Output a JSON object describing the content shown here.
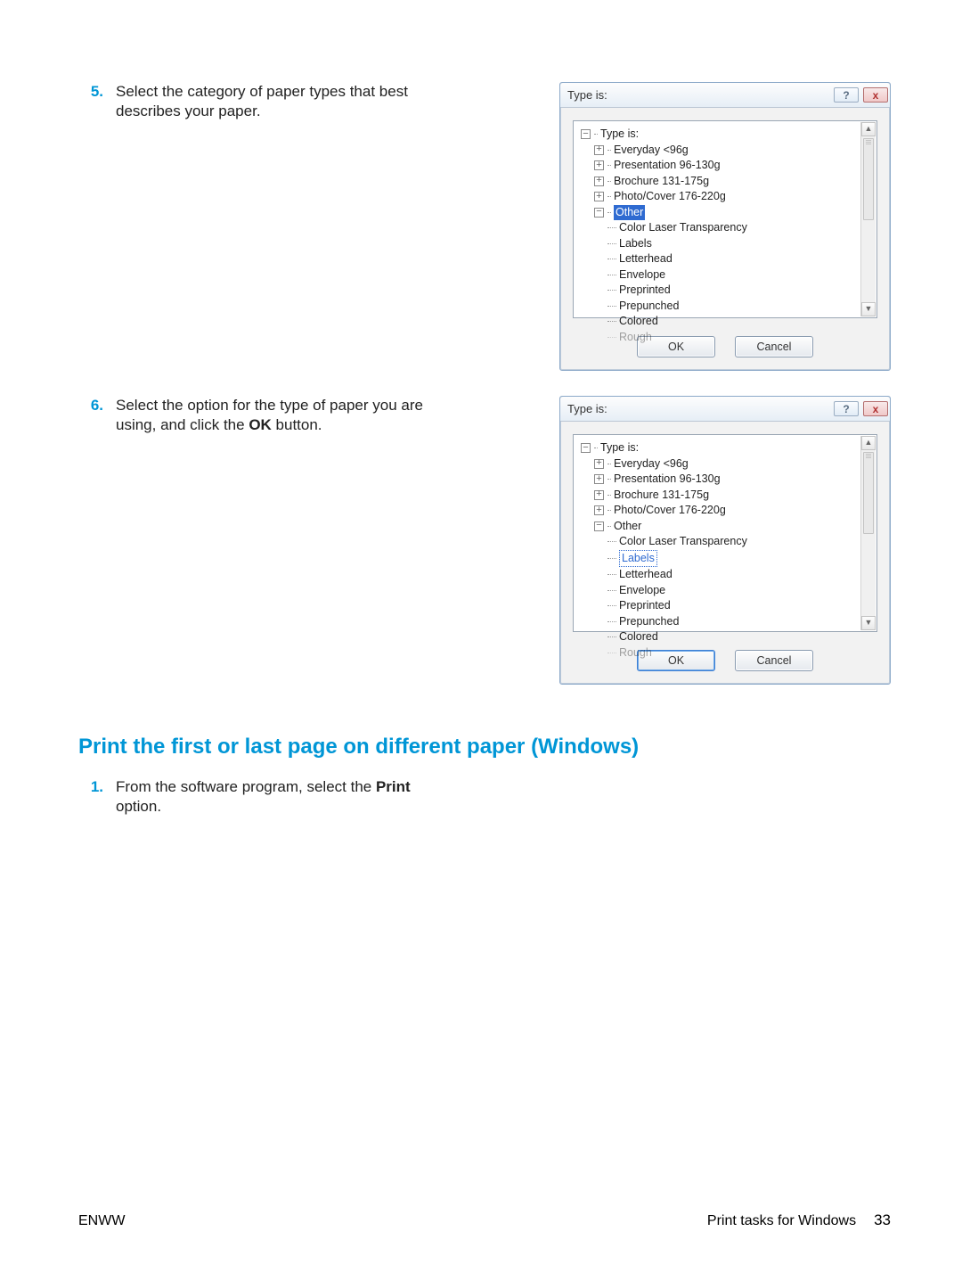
{
  "steps": {
    "5": {
      "num": "5.",
      "text_pre": "Select the category of paper types that best describes your paper."
    },
    "6": {
      "num": "6.",
      "text_pre": "Select the option for the type of paper you are using, and click the ",
      "bold": "OK",
      "text_post": " button."
    },
    "1b": {
      "num": "1.",
      "text_pre": "From the software program, select the ",
      "bold": "Print",
      "text_post": " option."
    }
  },
  "section_heading": "Print the first or last page on different paper (Windows)",
  "dialog": {
    "title": "Type is:",
    "help_glyph": "?",
    "close_glyph": "x",
    "ok": "OK",
    "cancel": "Cancel",
    "scroll_up": "▲",
    "scroll_down": "▼",
    "tree_root": "Type is:",
    "items_l1": {
      "everyday": "Everyday <96g",
      "presentation": "Presentation 96-130g",
      "brochure": "Brochure 131-175g",
      "photo": "Photo/Cover 176-220g",
      "other": "Other"
    },
    "items_l2": {
      "clt": "Color Laser Transparency",
      "labels": "Labels",
      "letterhead": "Letterhead",
      "envelope": "Envelope",
      "preprinted": "Preprinted",
      "prepunched": "Prepunched",
      "colored": "Colored",
      "rough": "Rough"
    }
  },
  "footer": {
    "left": "ENWW",
    "right": "Print tasks for Windows",
    "page": "33"
  }
}
